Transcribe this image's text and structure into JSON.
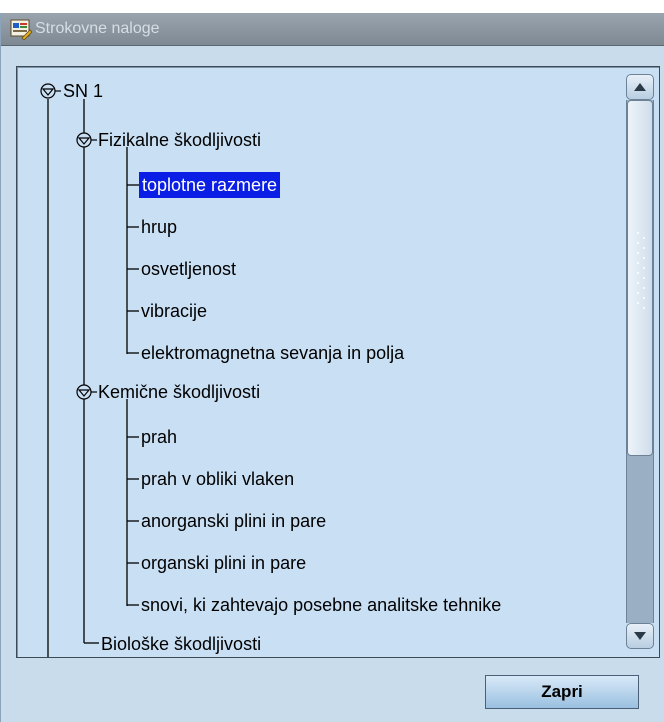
{
  "window": {
    "title": "Strokovne naloge",
    "icon": "form-icon"
  },
  "tree": {
    "root": "SN 1",
    "groups": [
      {
        "label": "Fizikalne škodljivosti",
        "expanded": true,
        "items": [
          "toplotne razmere",
          "hrup",
          "osvetljenost",
          "vibracije",
          "elektromagnetna sevanja in polja"
        ]
      },
      {
        "label": "Kemične škodljivosti",
        "expanded": true,
        "items": [
          "prah",
          "prah v obliki vlaken",
          "anorganski plini in pare",
          "organski plini in pare",
          "snovi, ki zahtevajo posebne analitske tehnike"
        ]
      },
      {
        "label": "Biološke škodljivosti",
        "expanded": false,
        "items": []
      }
    ],
    "selected": "toplotne razmere"
  },
  "buttons": {
    "close_label": "Zapri"
  },
  "colors": {
    "selection": "#0a1ee6",
    "panel": "#c9dff4",
    "window": "#c8dcec"
  }
}
